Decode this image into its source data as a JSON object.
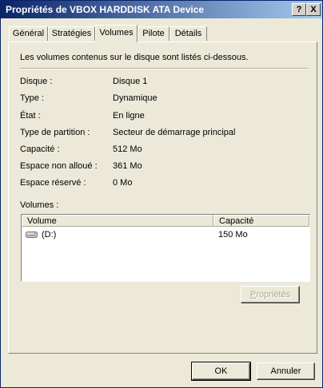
{
  "window": {
    "title": "Propriétés de VBOX HARDDISK ATA Device",
    "help_glyph": "?",
    "close_glyph": "X"
  },
  "tabs": [
    {
      "label": "Général"
    },
    {
      "label": "Stratégies"
    },
    {
      "label": "Volumes",
      "active": true
    },
    {
      "label": "Pilote"
    },
    {
      "label": "Détails"
    }
  ],
  "volumes_tab": {
    "intro": "Les volumes contenus sur le disque sont listés ci-dessous.",
    "properties": [
      {
        "label": "Disque :",
        "value": "Disque 1"
      },
      {
        "label": "Type :",
        "value": "Dynamique"
      },
      {
        "label": "État :",
        "value": "En ligne"
      },
      {
        "label": "Type de partition :",
        "value": "Secteur de démarrage principal"
      },
      {
        "label": "Capacité :",
        "value": "512 Mo"
      },
      {
        "label": "Espace non alloué :",
        "value": "361 Mo"
      },
      {
        "label": "Espace réservé :",
        "value": "0 Mo"
      }
    ],
    "volumes_label": "Volumes :",
    "columns": {
      "volume": "Volume",
      "capacity": "Capacité"
    },
    "rows": [
      {
        "volume": "(D:)",
        "capacity": "150 Mo",
        "icon": "drive-icon"
      }
    ],
    "properties_button": {
      "underline": "P",
      "rest": "ropriétés",
      "enabled": false
    }
  },
  "footer": {
    "ok_label": "OK",
    "cancel_label": "Annuler"
  }
}
